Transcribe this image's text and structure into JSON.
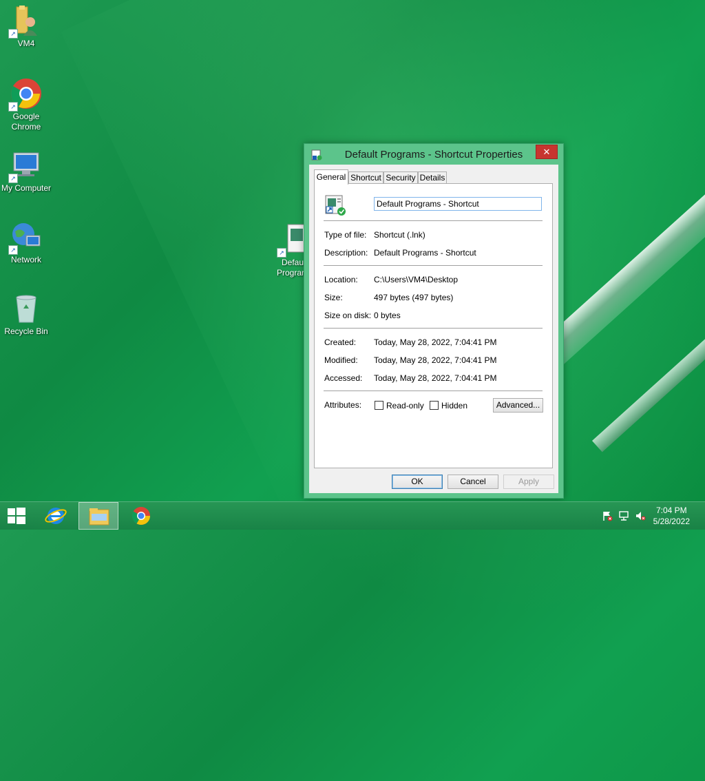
{
  "desktop": {
    "icons": [
      {
        "label": "VM4"
      },
      {
        "label": "Google Chrome"
      },
      {
        "label": "My Computer"
      },
      {
        "label": "Network"
      },
      {
        "label": "Recycle Bin"
      },
      {
        "label": "Default Programs"
      }
    ]
  },
  "dialog": {
    "title": "Default Programs - Shortcut Properties",
    "close_glyph": "✕",
    "tabs": [
      {
        "label": "General",
        "active": true
      },
      {
        "label": "Shortcut"
      },
      {
        "label": "Security"
      },
      {
        "label": "Details"
      }
    ],
    "name_value": "Default Programs - Shortcut",
    "fields": {
      "type_label": "Type of file:",
      "type_value": "Shortcut (.lnk)",
      "description_label": "Description:",
      "description_value": "Default Programs - Shortcut",
      "location_label": "Location:",
      "location_value": "C:\\Users\\VM4\\Desktop",
      "size_label": "Size:",
      "size_value": "497 bytes (497 bytes)",
      "size_on_disk_label": "Size on disk:",
      "size_on_disk_value": "0 bytes",
      "created_label": "Created:",
      "created_value": "Today, May 28, 2022, 7:04:41 PM",
      "modified_label": "Modified:",
      "modified_value": "Today, May 28, 2022, 7:04:41 PM",
      "accessed_label": "Accessed:",
      "accessed_value": "Today, May 28, 2022, 7:04:41 PM",
      "attributes_label": "Attributes:"
    },
    "attributes": {
      "readonly_label": "Read-only",
      "hidden_label": "Hidden",
      "advanced_label": "Advanced..."
    },
    "buttons": {
      "ok": "OK",
      "cancel": "Cancel",
      "apply": "Apply"
    }
  },
  "taskbar": {
    "clock_time": "7:04 PM",
    "clock_date": "5/28/2022"
  },
  "colors": {
    "dialog_frame": "#5cc48b",
    "close_button": "#c7352f",
    "desktop_green": "#11a050"
  }
}
